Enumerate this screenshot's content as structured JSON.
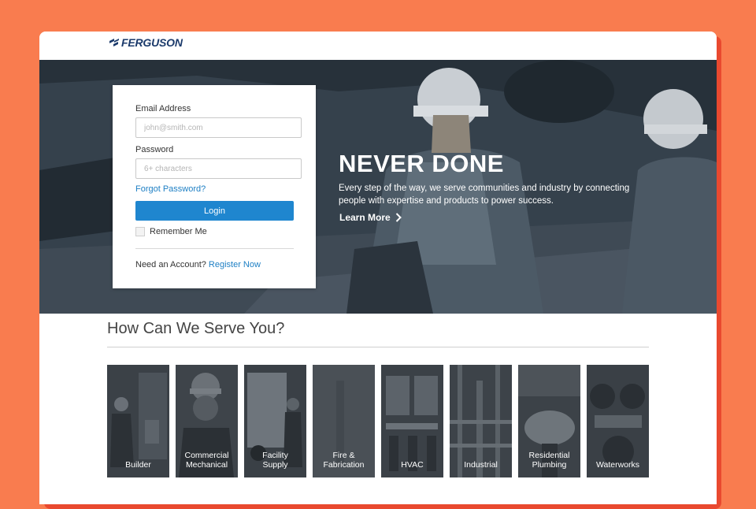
{
  "brand": {
    "name": "FERGUSON",
    "color": "#1b3a6b"
  },
  "login": {
    "email_label": "Email Address",
    "email_placeholder": "john@smith.com",
    "password_label": "Password",
    "password_placeholder": "6+ characters",
    "forgot_link": "Forgot Password?",
    "login_button": "Login",
    "remember_label": "Remember Me",
    "account_prompt": "Need an Account?",
    "register_link": "Register Now"
  },
  "hero": {
    "headline": "NEVER DONE",
    "subtext": "Every step of the way, we serve communities and industry by connecting people with expertise and products to power success.",
    "learn_more": "Learn More"
  },
  "serve": {
    "title": "How Can We Serve You?",
    "tiles": [
      {
        "label": "Builder",
        "icon": "builder-photo"
      },
      {
        "label": "Commercial\nMechanical",
        "icon": "commercial-mechanical-photo"
      },
      {
        "label": "Facility\nSupply",
        "icon": "facility-supply-photo"
      },
      {
        "label": "Fire &\nFabrication",
        "icon": "fire-fabrication-photo"
      },
      {
        "label": "HVAC",
        "icon": "hvac-photo"
      },
      {
        "label": "Industrial",
        "icon": "industrial-photo"
      },
      {
        "label": "Residential\nPlumbing",
        "icon": "residential-plumbing-photo"
      },
      {
        "label": "Waterworks",
        "icon": "waterworks-photo"
      }
    ]
  },
  "colors": {
    "background": "#f97c4f",
    "accent_blue": "#1f86cf",
    "link_blue": "#1d7fc4",
    "hero_tint": "#2f3a45"
  }
}
